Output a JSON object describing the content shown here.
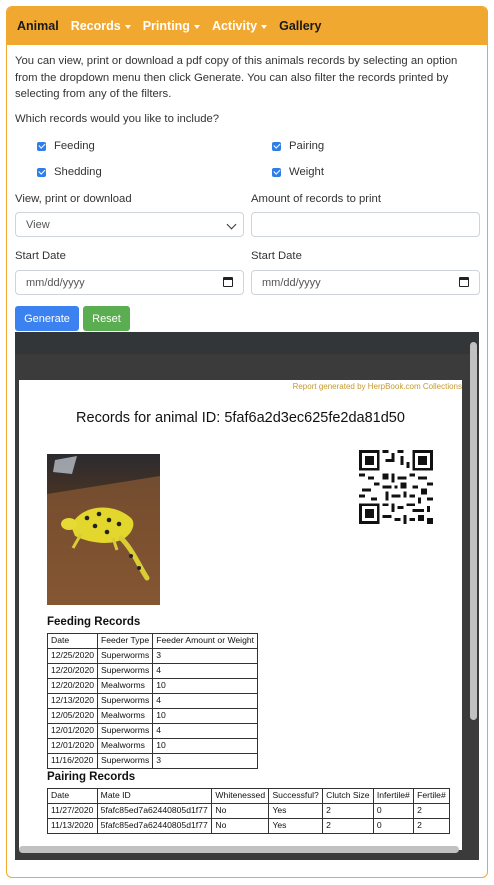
{
  "nav": {
    "items": [
      {
        "label": "Animal",
        "dropdown": false,
        "active": true
      },
      {
        "label": "Records",
        "dropdown": true,
        "active": false
      },
      {
        "label": "Printing",
        "dropdown": true,
        "active": false
      },
      {
        "label": "Activity",
        "dropdown": true,
        "active": false
      },
      {
        "label": "Gallery",
        "dropdown": false,
        "active": true
      }
    ]
  },
  "intro_text": "You can view, print or download a pdf copy of this animals records by selecting an option from the dropdown menu then click Generate. You can also filter the records printed by selecting from any of the filters.",
  "include_question": "Which records would you like to include?",
  "checkboxes": [
    {
      "label": "Feeding",
      "checked": true
    },
    {
      "label": "Pairing",
      "checked": true
    },
    {
      "label": "Shedding",
      "checked": true
    },
    {
      "label": "Weight",
      "checked": true
    }
  ],
  "view_label": "View, print or download",
  "view_select_value": "View",
  "amount_label": "Amount of records to print",
  "amount_value": "",
  "start_date_label": "Start Date",
  "start_date_placeholder": "mm/dd/yyyy",
  "end_date_label": "Start Date",
  "end_date_placeholder": "mm/dd/yyyy",
  "buttons": {
    "generate": "Generate",
    "reset": "Reset"
  },
  "colors": {
    "nav_accent": "#f0a830",
    "generate": "#3b82f0",
    "reset": "#5aad50",
    "note": "#c69a2e"
  },
  "report": {
    "generated_note": "Report generated by HerpBook.com Collections",
    "title": "Records for animal ID: 5faf6a2d3ec625fe2da81d50",
    "feeding": {
      "title": "Feeding Records",
      "headers": [
        "Date",
        "Feeder Type",
        "Feeder Amount or Weight"
      ],
      "rows": [
        [
          "12/25/2020",
          "Superworms",
          "3"
        ],
        [
          "12/20/2020",
          "Superworms",
          "4"
        ],
        [
          "12/20/2020",
          "Mealworms",
          "10"
        ],
        [
          "12/13/2020",
          "Superworms",
          "4"
        ],
        [
          "12/05/2020",
          "Mealworms",
          "10"
        ],
        [
          "12/01/2020",
          "Superworms",
          "4"
        ],
        [
          "12/01/2020",
          "Mealworms",
          "10"
        ],
        [
          "11/16/2020",
          "Superworms",
          "3"
        ]
      ]
    },
    "pairing": {
      "title": "Pairing Records",
      "headers": [
        "Date",
        "Mate ID",
        "Whitenessed",
        "Successful?",
        "Clutch Size",
        "Infertile#",
        "Fertile#"
      ],
      "rows": [
        [
          "11/27/2020",
          "5fafc85ed7a62440805d1f77",
          "No",
          "Yes",
          "2",
          "0",
          "2"
        ],
        [
          "11/13/2020",
          "5fafc85ed7a62440805d1f77",
          "No",
          "Yes",
          "2",
          "0",
          "2"
        ]
      ]
    }
  }
}
